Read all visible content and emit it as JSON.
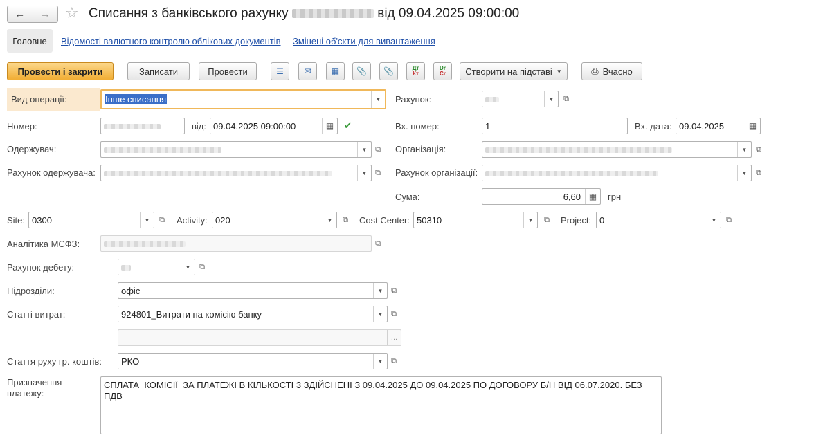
{
  "window": {
    "title_prefix": "Списання з банківського рахунку",
    "title_suffix": "від 09.04.2025 09:00:00"
  },
  "tabs": {
    "main": "Головне",
    "currency_control": "Відомості валютного контролю облікових документів",
    "changed_objects": "Змінені об'єкти для вивантаження"
  },
  "toolbar": {
    "post_close": "Провести і закрити",
    "save": "Записати",
    "post": "Провести",
    "create_based": "Створити на підставі",
    "print": "Вчасно",
    "dt_label": "Дт",
    "kt_label": "Кт",
    "dr_label": "Dr",
    "cr_label": "Cr"
  },
  "form": {
    "operation_type": {
      "label": "Вид операції:",
      "value": "Інше списання"
    },
    "account": {
      "label": "Рахунок:"
    },
    "number": {
      "label": "Номер:"
    },
    "date_from": {
      "label": "від:",
      "value": "09.04.2025 09:00:00"
    },
    "in_number": {
      "label": "Вх. номер:",
      "value": "1"
    },
    "in_date": {
      "label": "Вх. дата:",
      "value": "09.04.2025"
    },
    "recipient": {
      "label": "Одержувач:"
    },
    "organization": {
      "label": "Організація:"
    },
    "recipient_account": {
      "label": "Рахунок одержувача:"
    },
    "org_account": {
      "label": "Рахунок організації:"
    },
    "amount": {
      "label": "Сума:",
      "value": "6,60",
      "currency": "грн"
    },
    "site": {
      "label": "Site:",
      "value": "0300"
    },
    "activity": {
      "label": "Activity:",
      "value": "020"
    },
    "cost_center": {
      "label": "Cost Center:",
      "value": "50310"
    },
    "project": {
      "label": "Project:",
      "value": "0"
    },
    "ifrs_analytics": {
      "label": "Аналітика МСФЗ:"
    },
    "debit_account": {
      "label": "Рахунок дебету:"
    },
    "departments": {
      "label": "Підрозділи:",
      "value": "офіс"
    },
    "expense_items": {
      "label": "Статті витрат:",
      "value": "924801_Витрати на комісію банку"
    },
    "extra": {
      "value": "",
      "button": "..."
    },
    "cash_flow_item": {
      "label": "Стаття руху гр. коштів:",
      "value": "РКО"
    },
    "payment_purpose": {
      "label_line1": "Призначення",
      "label_line2": "платежу:",
      "value": "СПЛАТА  КОМІСІЇ  ЗА ПЛАТЕЖІ В КІЛЬКОСТІ 3 ЗДІЙСНЕНІ З 09.04.2025 ДО 09.04.2025 ПО ДОГОВОРУ Б/Н ВІД 06.07.2020. БЕЗ ПДВ"
    }
  },
  "colors": {
    "accent": "#f1ae35",
    "link": "#1f4fa8",
    "highlight_label_bg": "#fbe9cf",
    "selection": "#3b6fc8"
  }
}
